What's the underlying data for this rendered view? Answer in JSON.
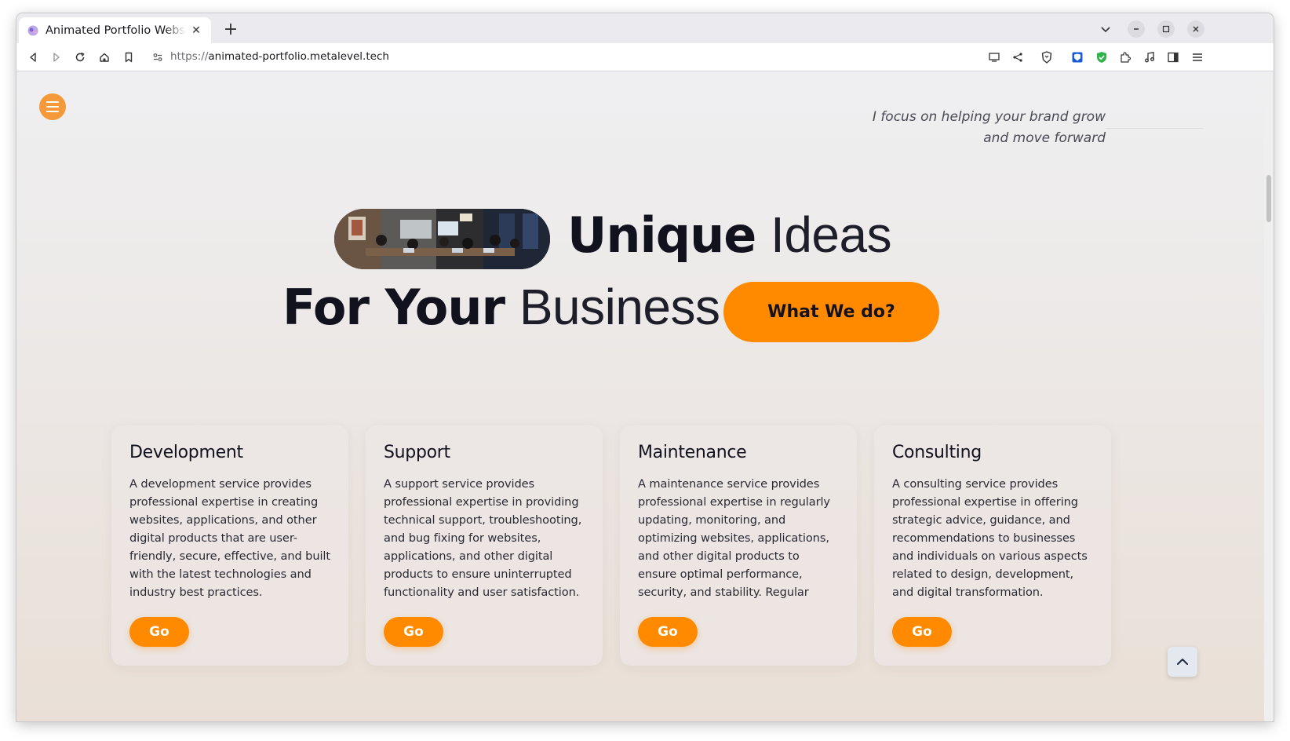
{
  "browser": {
    "tab_title": "Animated Portfolio Website",
    "url_scheme": "https://",
    "url_host": "animated-portfolio.metalevel.tech"
  },
  "page": {
    "tagline_line1": "I focus on helping your brand grow",
    "tagline_line2": "and move forward",
    "hero": {
      "line1_bold": "Unique",
      "line1_light": "Ideas",
      "line2_bold": "For Your",
      "line2_light": "Business",
      "cta_label": "What We do?"
    },
    "services": [
      {
        "title": "Development",
        "description": "A development service provides professional expertise in creating websites, applications, and other digital products that are user-friendly, secure, effective, and built with the latest technologies and industry best practices. Developers...",
        "button": "Go"
      },
      {
        "title": "Support",
        "description": "A support service provides professional expertise in providing technical support, troubleshooting, and bug fixing for websites, applications, and other digital products to ensure uninterrupted functionality and user satisfaction. Support teams...",
        "button": "Go"
      },
      {
        "title": "Maintenance",
        "description": "A maintenance service provides professional expertise in regularly updating, monitoring, and optimizing websites, applications, and other digital products to ensure optimal performance, security, and stability. Regular maintenance ac-...",
        "button": "Go"
      },
      {
        "title": "Consulting",
        "description": "A consulting service provides professional expertise in offering strategic advice, guidance, and recommendations to businesses and individuals on various aspects related to design, development, and digital transformation. Consultants...",
        "button": "Go"
      }
    ]
  },
  "colors": {
    "accent": "#ff8a00",
    "menu_button": "#f59a3a",
    "heading": "#12121e"
  },
  "icons": {
    "menu": "hamburger-icon",
    "scroll_top": "chevron-up-icon"
  }
}
